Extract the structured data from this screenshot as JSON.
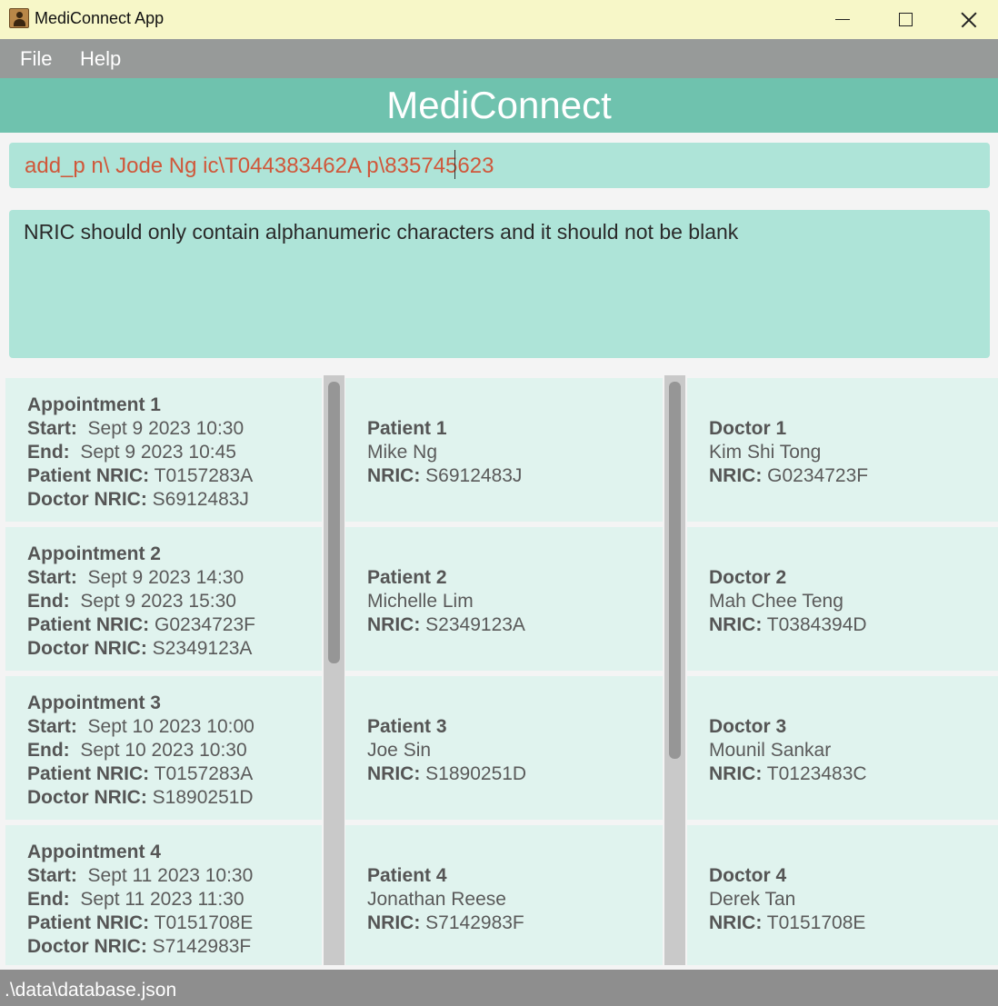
{
  "window": {
    "title": "MediConnect App",
    "icon": "address-book-icon"
  },
  "menu": {
    "file": "File",
    "help": "Help"
  },
  "header": {
    "title": "MediConnect"
  },
  "command": {
    "text": "add_p n\\ Jode Ng ic\\T044383462A p\\835745623"
  },
  "result": {
    "text": "NRIC should only contain alphanumeric characters and it should not be blank"
  },
  "labels": {
    "start": "Start:",
    "end": "End:",
    "patient_nric": "Patient NRIC:",
    "doctor_nric": "Doctor NRIC:",
    "nric": "NRIC:"
  },
  "appointments": [
    {
      "title": "Appointment 1",
      "start": "Sept 9 2023 10:30",
      "end": "Sept 9 2023 10:45",
      "patient_nric": "T0157283A",
      "doctor_nric": "S6912483J"
    },
    {
      "title": "Appointment 2",
      "start": "Sept 9 2023 14:30",
      "end": "Sept 9 2023 15:30",
      "patient_nric": "G0234723F",
      "doctor_nric": "S2349123A"
    },
    {
      "title": "Appointment 3",
      "start": "Sept 10 2023 10:00",
      "end": "Sept 10 2023 10:30",
      "patient_nric": "T0157283A",
      "doctor_nric": "S1890251D"
    },
    {
      "title": "Appointment 4",
      "start": "Sept 11 2023 10:30",
      "end": "Sept 11 2023 11:30",
      "patient_nric": "T0151708E",
      "doctor_nric": "S7142983F"
    }
  ],
  "patients": [
    {
      "title": "Patient 1",
      "name": "Mike Ng",
      "nric": "S6912483J"
    },
    {
      "title": "Patient 2",
      "name": "Michelle Lim",
      "nric": "S2349123A"
    },
    {
      "title": "Patient 3",
      "name": "Joe Sin",
      "nric": "S1890251D"
    },
    {
      "title": "Patient 4",
      "name": "Jonathan Reese",
      "nric": "S7142983F"
    }
  ],
  "doctors": [
    {
      "title": "Doctor 1",
      "name": "Kim Shi Tong",
      "nric": "G0234723F"
    },
    {
      "title": "Doctor 2",
      "name": "Mah Chee Teng",
      "nric": "T0384394D"
    },
    {
      "title": "Doctor 3",
      "name": "Mounil Sankar",
      "nric": "T0123483C"
    },
    {
      "title": "Doctor 4",
      "name": "Derek Tan",
      "nric": "T0151708E"
    }
  ],
  "status": {
    "path": ".\\data\\database.json"
  },
  "colors": {
    "titlebar": "#f7f7c8",
    "menubar": "#979a99",
    "header": "#6fc2ae",
    "input_bg": "#aee4d8",
    "card_bg": "#e0f3ee",
    "command_text": "#d0573a",
    "statusbar": "#8e8e8e"
  }
}
